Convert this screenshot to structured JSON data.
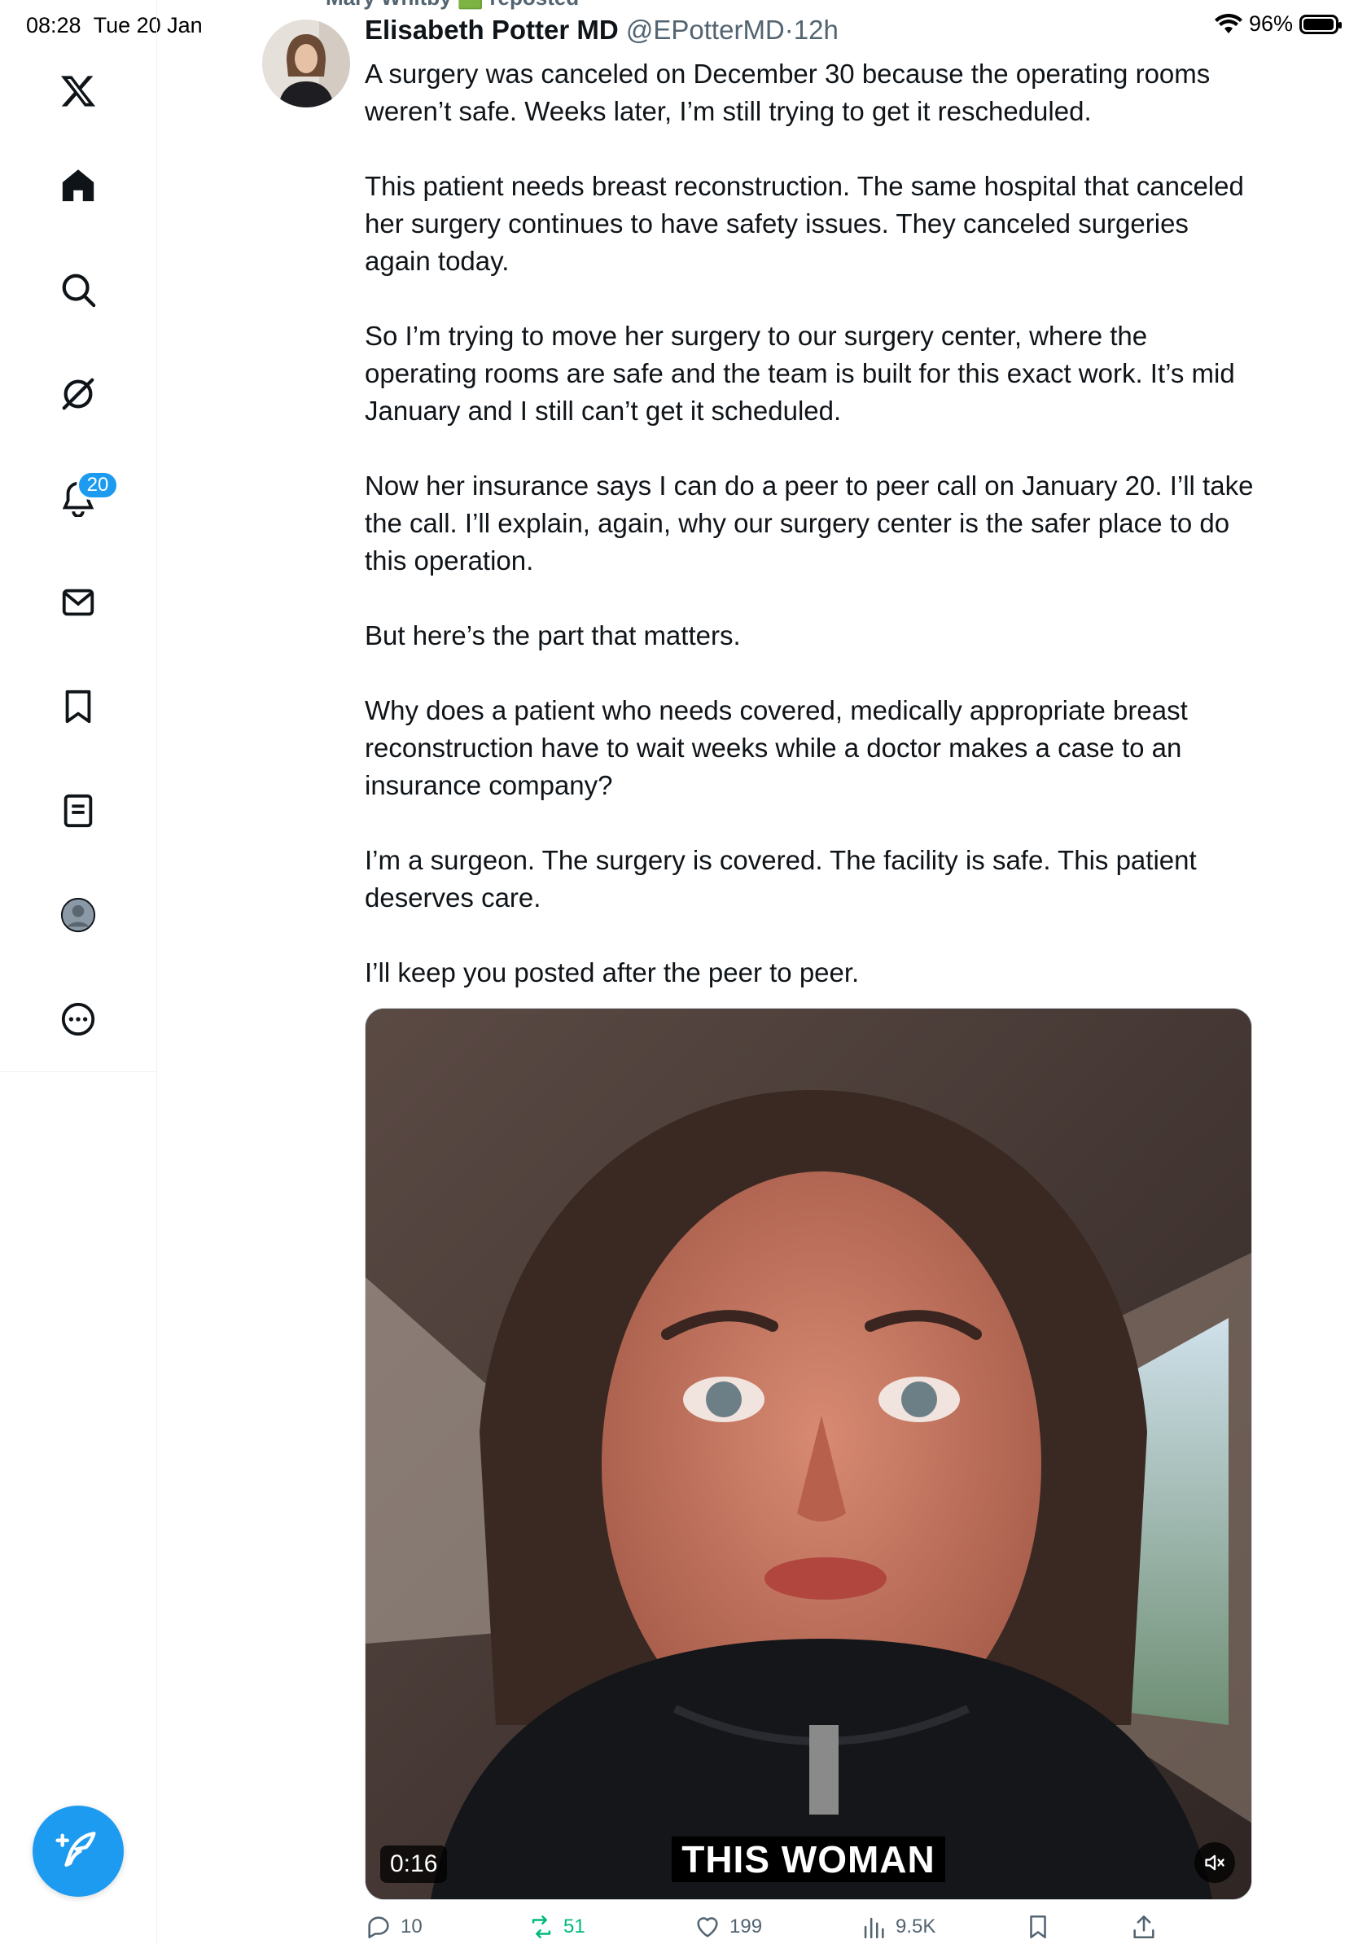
{
  "status_bar": {
    "time": "08:28",
    "date": "Tue 20 Jan",
    "battery": "96%"
  },
  "sidebar": {
    "items": [
      {
        "name": "x-logo-icon"
      },
      {
        "name": "home-icon"
      },
      {
        "name": "search-icon"
      },
      {
        "name": "grok-icon"
      },
      {
        "name": "notifications-icon",
        "badge": "20"
      },
      {
        "name": "messages-icon"
      },
      {
        "name": "bookmarks-icon"
      },
      {
        "name": "lists-icon"
      },
      {
        "name": "profile-icon"
      },
      {
        "name": "more-icon"
      }
    ],
    "compose_icon": "compose-post-icon"
  },
  "post": {
    "reposted_by": "Mary Whitby 🟩 reposted",
    "author_name": "Elisabeth Potter MD",
    "handle": "@EPotterMD",
    "separator": "·",
    "time": "12h",
    "paragraphs": [
      "A surgery was canceled on December 30 because the operating rooms weren’t safe. Weeks later, I’m still trying to get it rescheduled.",
      "This patient needs breast reconstruction. The same hospital that canceled her surgery continues to have safety issues. They canceled surgeries again today.",
      "So I’m trying to move her surgery to our surgery center, where the operating rooms are safe and the team is built for this exact work. It’s mid January and I still can’t get it scheduled.",
      "Now her insurance says I can do a peer to peer call on January 20. I’ll take the call. I’ll explain, again, why our surgery center is the safer place to do this operation.",
      "But here’s the part that matters.",
      "Why does a patient who needs covered, medically appropriate breast reconstruction have to wait weeks while a doctor makes a case to an insurance company?",
      "I’m a surgeon. The surgery is covered. The facility is safe. This patient deserves care.",
      "I’ll keep you posted after the peer to peer."
    ],
    "video": {
      "duration": "0:16",
      "caption": "THIS WOMAN"
    },
    "actions": {
      "replies": "10",
      "reposts": "51",
      "likes": "199",
      "views": "9.5K"
    }
  },
  "colors": {
    "accent": "#1d9bf0",
    "repost_green": "#00ba7c",
    "muted_text": "#536471"
  }
}
